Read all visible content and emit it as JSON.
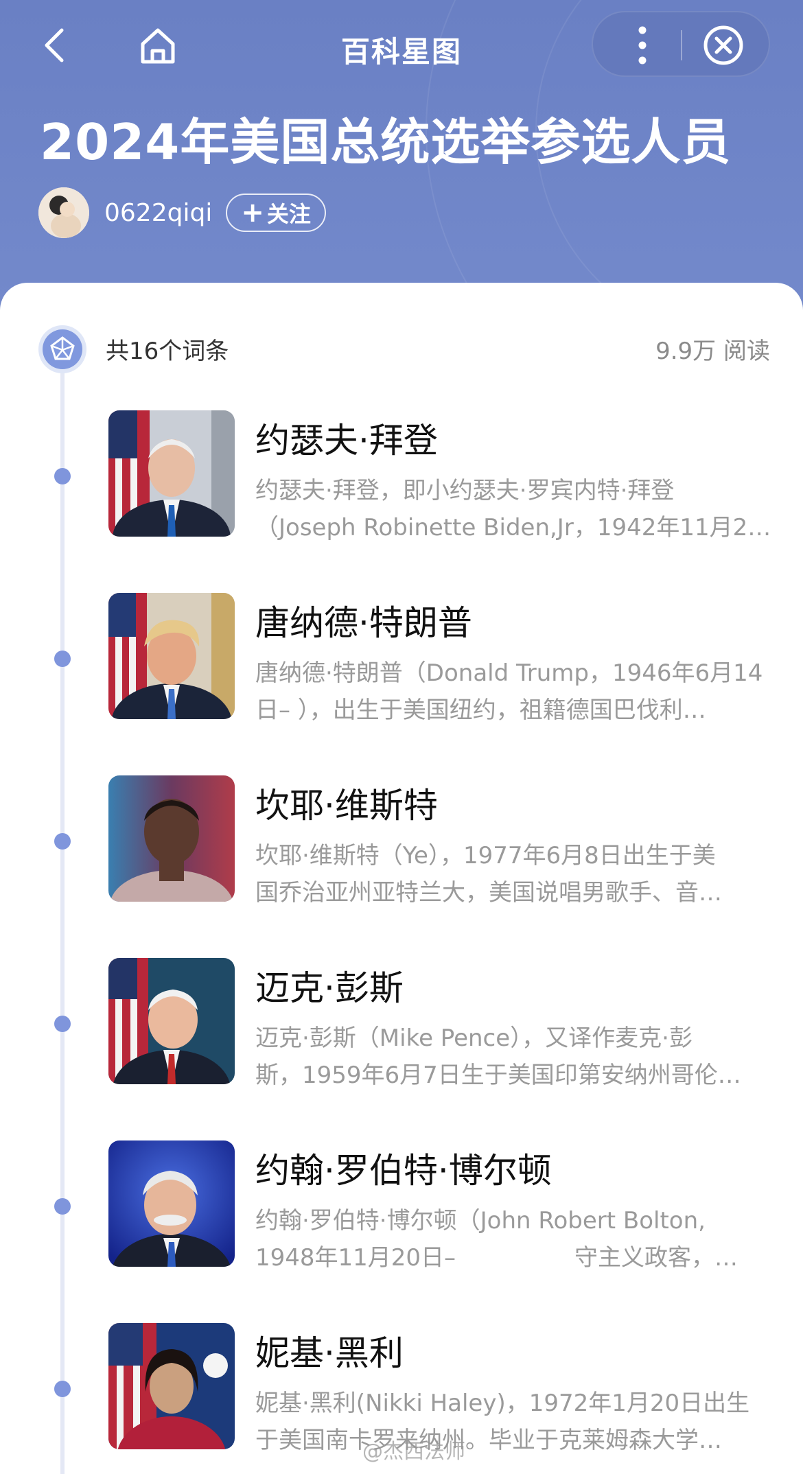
{
  "nav": {
    "title": "百科星图",
    "back_icon": "chevron-left-icon",
    "home_icon": "home-icon",
    "more_icon": "more-vertical-icon",
    "close_icon": "close-circle-icon"
  },
  "header": {
    "title": "2024年美国总统选举参选人员",
    "author": "0622qiqi",
    "follow_label": "关注",
    "follow_prefix": "+"
  },
  "summary": {
    "count_label": "共16个词条",
    "reads_label": "9.9万 阅读"
  },
  "entries": [
    {
      "name": "约瑟夫·拜登",
      "line1": "约瑟夫·拜登，即小约瑟夫·罗宾内特·拜登",
      "line2": "（Joseph Robinette Biden,Jr，1942年11月2…"
    },
    {
      "name": "唐纳德·特朗普",
      "line1": "唐纳德·特朗普（Donald Trump，1946年6月14",
      "line2": "日– ），出生于美国纽约，祖籍德国巴伐利…"
    },
    {
      "name": "坎耶·维斯特",
      "line1": "坎耶·维斯特（Ye），1977年6月8日出生于美",
      "line2": "国乔治亚州亚特兰大，美国说唱男歌手、音…"
    },
    {
      "name": "迈克·彭斯",
      "line1": "迈克·彭斯（Mike Pence），又译作麦克·彭",
      "line2": "斯，1959年6月7日生于美国印第安纳州哥伦…"
    },
    {
      "name": "约翰·罗伯特·博尔顿",
      "line1": "约翰·罗伯特·博尔顿（John Robert Bolton,",
      "line2": "1948年11月20日–                守主义政客，…"
    },
    {
      "name": "妮基·黑利",
      "line1": "妮基·黑利(Nikki Haley)，1972年1月20日出生",
      "line2": "于美国南卡罗来纳州。毕业于克莱姆森大学…"
    }
  ],
  "watermark": "@杰西法师",
  "colors": {
    "header_bg": "#6f86c7",
    "accent": "#7f95dc",
    "text_primary": "#111111",
    "text_secondary": "#9a9a9a"
  }
}
